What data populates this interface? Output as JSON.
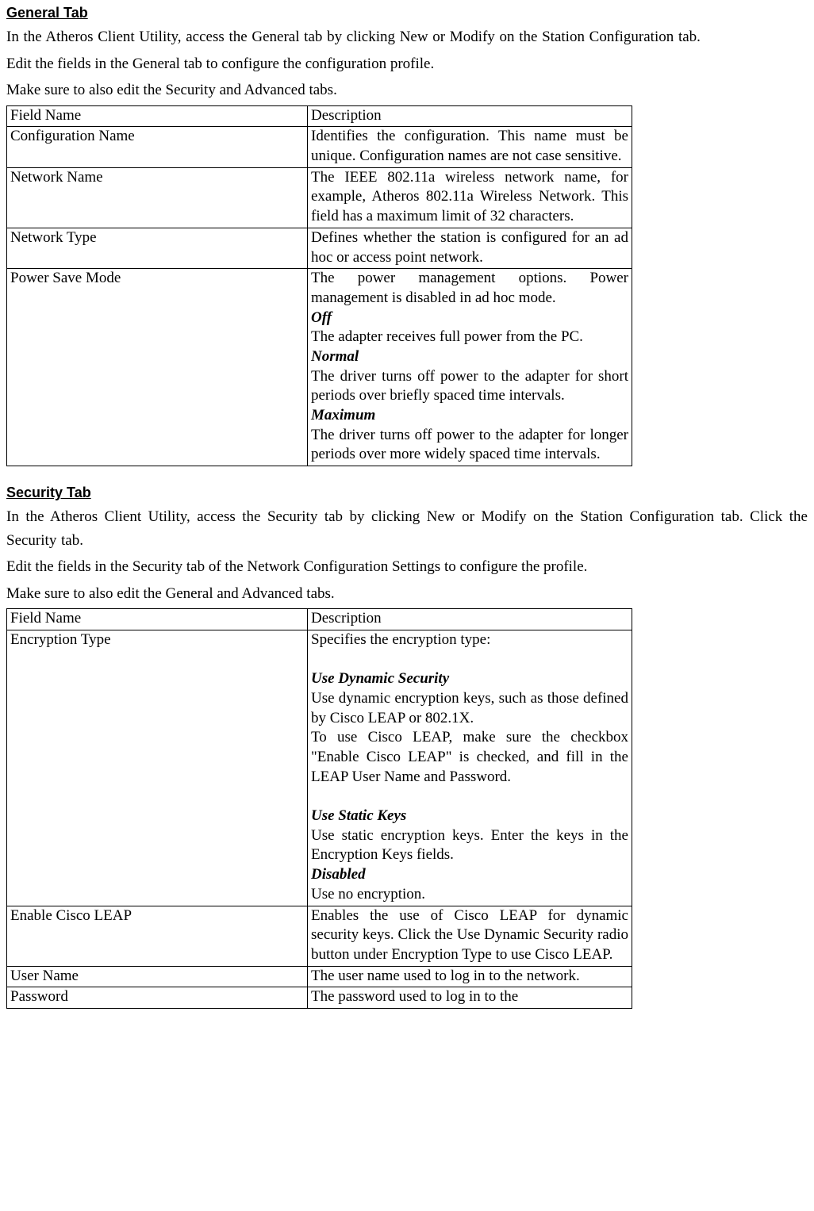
{
  "general": {
    "heading": "General Tab",
    "intro1": "In the Atheros Client Utility, access the General tab by clicking New or Modify on the Station Configuration tab.",
    "intro2": "Edit the fields in the General tab to configure the configuration profile.",
    "intro3": "Make sure to also edit the Security and Advanced tabs.",
    "header_field": "Field Name",
    "header_desc": "Description",
    "rows": {
      "r1_name": "Configuration Name",
      "r1_desc": "Identifies the configuration. This name must be unique. Configuration names are not case sensitive.",
      "r2_name": "Network Name",
      "r2_desc": "The IEEE 802.11a wireless network name, for example, Atheros 802.11a Wireless Network. This field has a maximum limit of 32 characters.",
      "r3_name": "Network Type",
      "r3_desc": "Defines whether the station is configured for an ad hoc or access point network.",
      "r4_name": "Power Save Mode",
      "r4_intro": "The power management options. Power management is disabled in ad hoc mode.",
      "r4_off_label": "Off",
      "r4_off_desc": "The adapter receives full power from the PC.",
      "r4_normal_label": "Normal",
      "r4_normal_desc": "The driver turns off power to the adapter for short periods over briefly spaced time intervals.",
      "r4_max_label": "Maximum",
      "r4_max_desc": "The driver turns off power to the adapter for longer periods over more widely spaced time intervals."
    }
  },
  "security": {
    "heading": "Security Tab",
    "intro1": "In the Atheros Client Utility, access the Security tab by clicking New or Modify on the Station Configuration tab.   Click the Security tab.",
    "intro2": "Edit the fields in the Security   tab of the Network Configuration Settings to configure the profile.",
    "intro3": "Make sure to also edit the General and Advanced tabs.",
    "header_field": "Field Name",
    "header_desc": "Description",
    "rows": {
      "r1_name": "Encryption Type",
      "r1_intro": "Specifies the encryption type:",
      "r1_dyn_label": "Use Dynamic Security",
      "r1_dyn_desc1": "Use dynamic encryption keys, such as those defined by Cisco LEAP or 802.1X.",
      "r1_dyn_desc2": "To use Cisco LEAP, make sure the checkbox \"Enable Cisco LEAP\" is checked, and fill in the LEAP User Name and Password.",
      "r1_stat_label": "Use Static Keys",
      "r1_stat_desc": "Use static encryption keys. Enter the keys in the Encryption Keys fields.",
      "r1_dis_label": "Disabled",
      "r1_dis_desc": "Use no encryption.",
      "r2_name": "Enable Cisco LEAP",
      "r2_desc": "Enables the use of Cisco LEAP for dynamic security keys.  Click the Use Dynamic Security radio button under Encryption Type to use Cisco LEAP.",
      "r3_name": "User Name",
      "r3_desc": "The user name used to log in to the network.",
      "r4_name": "Password",
      "r4_desc": "The password used to log in to the"
    }
  }
}
